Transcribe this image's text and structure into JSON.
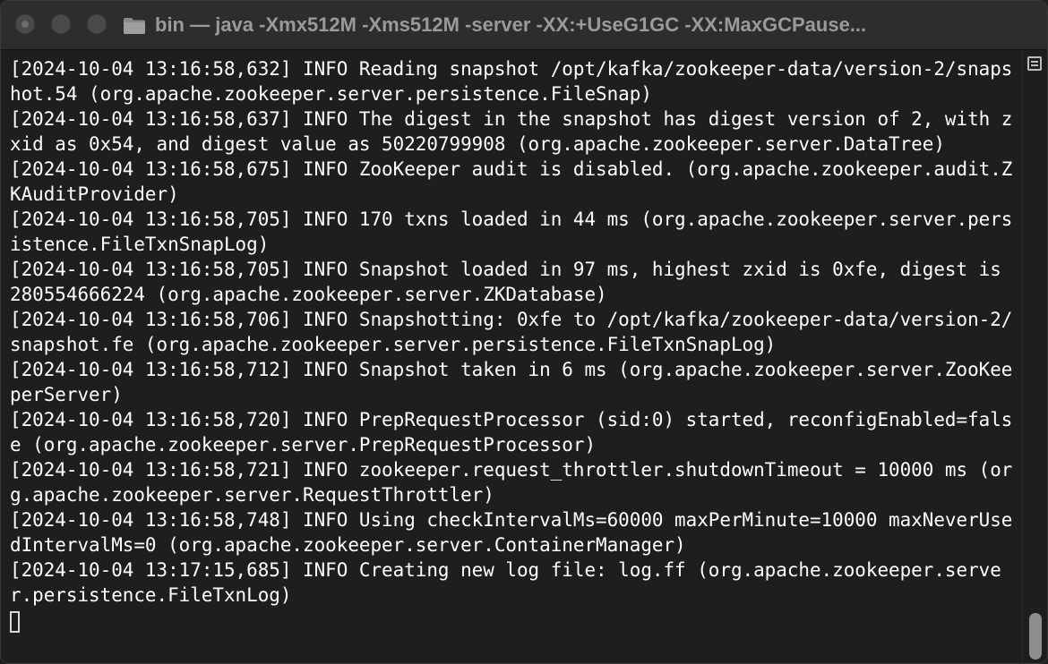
{
  "window": {
    "title": "bin — java -Xmx512M -Xms512M -server -XX:+UseG1GC -XX:MaxGCPause..."
  },
  "icons": {
    "title_icon": "folder-icon",
    "scroll_menu": "hamburger-menu-icon"
  },
  "colors": {
    "background": "#1e1e1e",
    "text": "#ffffff",
    "titlebar": "#2d2d2d"
  },
  "terminal": {
    "lines": [
      "[2024-10-04 13:16:58,632] INFO Reading snapshot /opt/kafka/zookeeper-data/version-2/snapshot.54 (org.apache.zookeeper.server.persistence.FileSnap)",
      "[2024-10-04 13:16:58,637] INFO The digest in the snapshot has digest version of 2, with zxid as 0x54, and digest value as 50220799908 (org.apache.zookeeper.server.DataTree)",
      "[2024-10-04 13:16:58,675] INFO ZooKeeper audit is disabled. (org.apache.zookeeper.audit.ZKAuditProvider)",
      "[2024-10-04 13:16:58,705] INFO 170 txns loaded in 44 ms (org.apache.zookeeper.server.persistence.FileTxnSnapLog)",
      "[2024-10-04 13:16:58,705] INFO Snapshot loaded in 97 ms, highest zxid is 0xfe, digest is 280554666224 (org.apache.zookeeper.server.ZKDatabase)",
      "[2024-10-04 13:16:58,706] INFO Snapshotting: 0xfe to /opt/kafka/zookeeper-data/version-2/snapshot.fe (org.apache.zookeeper.server.persistence.FileTxnSnapLog)",
      "[2024-10-04 13:16:58,712] INFO Snapshot taken in 6 ms (org.apache.zookeeper.server.ZooKeeperServer)",
      "[2024-10-04 13:16:58,720] INFO PrepRequestProcessor (sid:0) started, reconfigEnabled=false (org.apache.zookeeper.server.PrepRequestProcessor)",
      "[2024-10-04 13:16:58,721] INFO zookeeper.request_throttler.shutdownTimeout = 10000 ms (org.apache.zookeeper.server.RequestThrottler)",
      "[2024-10-04 13:16:58,748] INFO Using checkIntervalMs=60000 maxPerMinute=10000 maxNeverUsedIntervalMs=0 (org.apache.zookeeper.server.ContainerManager)",
      "[2024-10-04 13:17:15,685] INFO Creating new log file: log.ff (org.apache.zookeeper.server.persistence.FileTxnLog)"
    ]
  }
}
